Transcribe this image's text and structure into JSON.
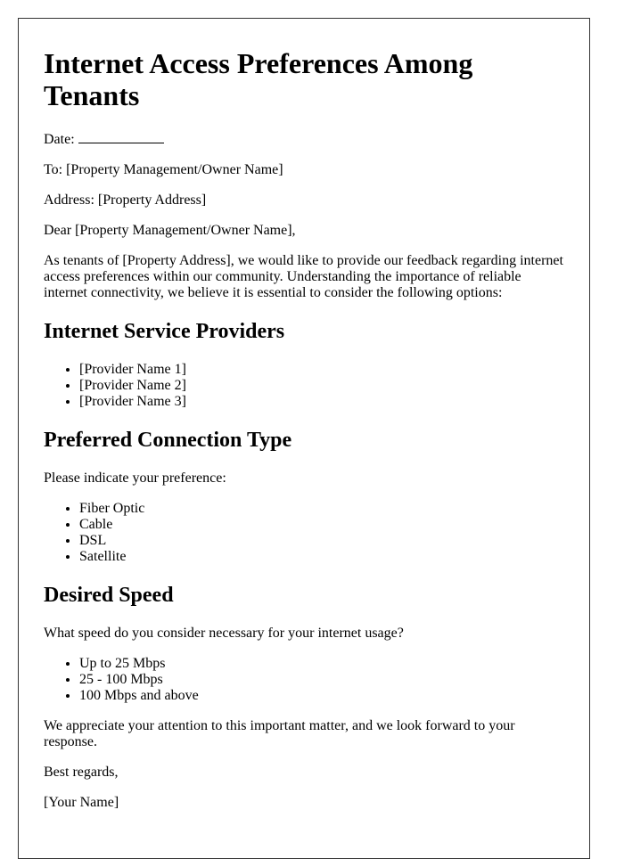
{
  "title": "Internet Access Preferences Among Tenants",
  "header": {
    "date_label": "Date:",
    "to_line": "To: [Property Management/Owner Name]",
    "address_line": "Address: [Property Address]",
    "salutation": "Dear [Property Management/Owner Name],"
  },
  "intro": "As tenants of [Property Address], we would like to provide our feedback regarding internet access preferences within our community. Understanding the importance of reliable internet connectivity, we believe it is essential to consider the following options:",
  "sections": [
    {
      "heading": "Internet Service Providers",
      "items": [
        "[Provider Name 1]",
        "[Provider Name 2]",
        "[Provider Name 3]"
      ]
    },
    {
      "heading": "Preferred Connection Type",
      "prompt": "Please indicate your preference:",
      "items": [
        "Fiber Optic",
        "Cable",
        "DSL",
        "Satellite"
      ]
    },
    {
      "heading": "Desired Speed",
      "prompt": "What speed do you consider necessary for your internet usage?",
      "items": [
        "Up to 25 Mbps",
        "25 - 100 Mbps",
        "100 Mbps and above"
      ]
    }
  ],
  "closing": "We appreciate your attention to this important matter, and we look forward to your response.",
  "signoff": "Best regards,",
  "signature": "[Your Name]"
}
